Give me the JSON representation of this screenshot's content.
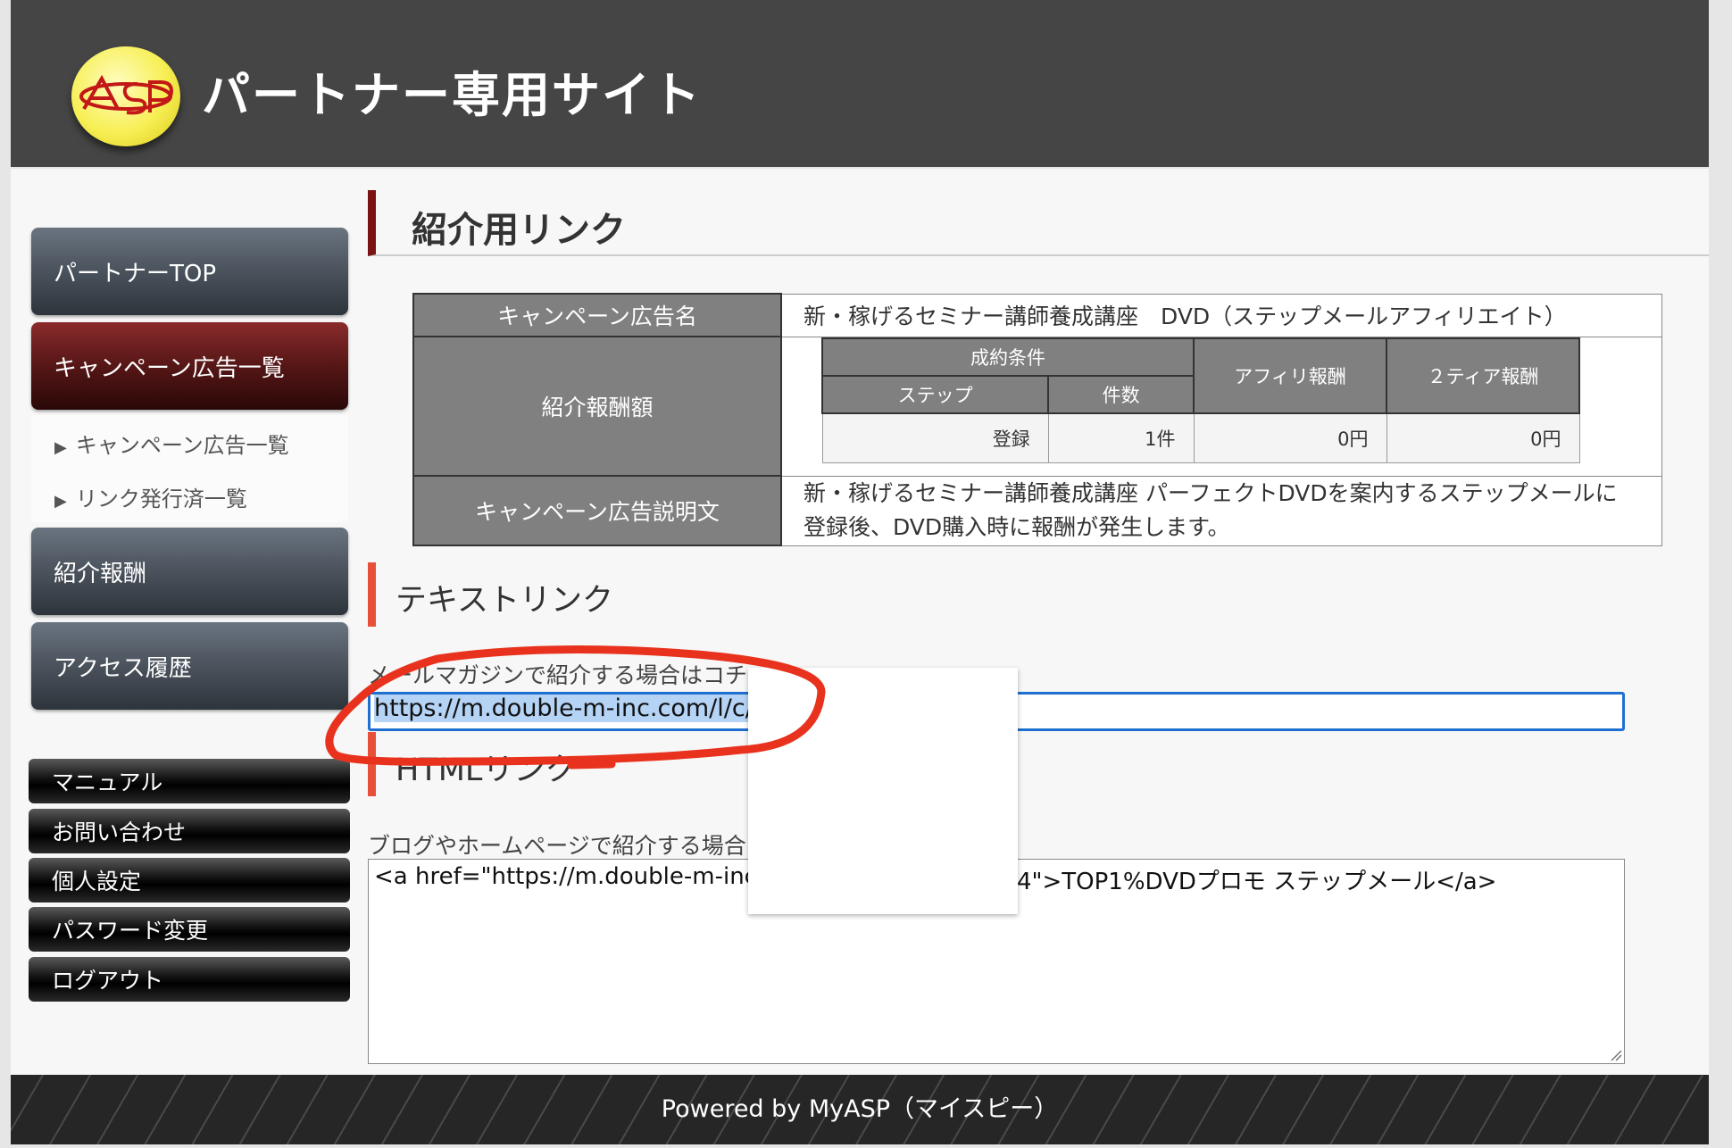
{
  "header": {
    "site_title": "パートナー専用サイト",
    "logo_text": "ASP"
  },
  "sidebar": {
    "main_items": [
      {
        "label": "パートナーTOP",
        "active": false
      },
      {
        "label": "キャンペーン広告一覧",
        "active": true
      },
      {
        "label": "紹介報酬",
        "active": false
      },
      {
        "label": "アクセス履歴",
        "active": false
      }
    ],
    "sub_items": [
      {
        "label": "キャンペーン広告一覧"
      },
      {
        "label": "リンク発行済一覧"
      }
    ],
    "util_items": [
      {
        "label": "マニュアル"
      },
      {
        "label": "お問い合わせ"
      },
      {
        "label": "個人設定"
      },
      {
        "label": "パスワード変更"
      },
      {
        "label": "ログアウト"
      }
    ]
  },
  "main": {
    "page_title": "紹介用リンク",
    "info_table": {
      "campaign_name_label": "キャンペーン広告名",
      "campaign_name": "新・稼げるセミナー講師養成講座　DVD（ステップメールアフィリエイト）",
      "reward_label": "紹介報酬額",
      "reward_table": {
        "condition_header": "成約条件",
        "step_header": "ステップ",
        "count_header": "件数",
        "affiliate_header": "アフィリ報酬",
        "tier2_header": "２ティア報酬",
        "step": "登録",
        "count": "1件",
        "affiliate": "0円",
        "tier2": "0円"
      },
      "description_label": "キャンペーン広告説明文",
      "description_line1": "新・稼げるセミナー講師養成講座 パーフェクトDVDを案内するステップメールに",
      "description_line2": "登録後、DVD購入時に報酬が発生します。"
    },
    "text_link": {
      "heading": "テキストリンク",
      "caption": "メールマガジンで紹介する場合はコチ",
      "value": "https://m.double-m-inc.com/l/c/lI"
    },
    "html_link": {
      "heading": "HTMLリンク",
      "caption": "ブログやホームページで紹介する場合",
      "value_start": "<a href=\"https://m.double-m-inc.c",
      "value_end": "4\">TOP1%DVDプロモ ステップメール</a>"
    }
  },
  "footer": {
    "text": "Powered by MyASP（マイスピー）"
  },
  "colors": {
    "header_bg": "#454545",
    "active_nav": "#561616",
    "heading_accent": "#7a1414",
    "section_accent": "#e8503a",
    "focus_border": "#1f6fd1",
    "annotation": "#e8321e"
  }
}
